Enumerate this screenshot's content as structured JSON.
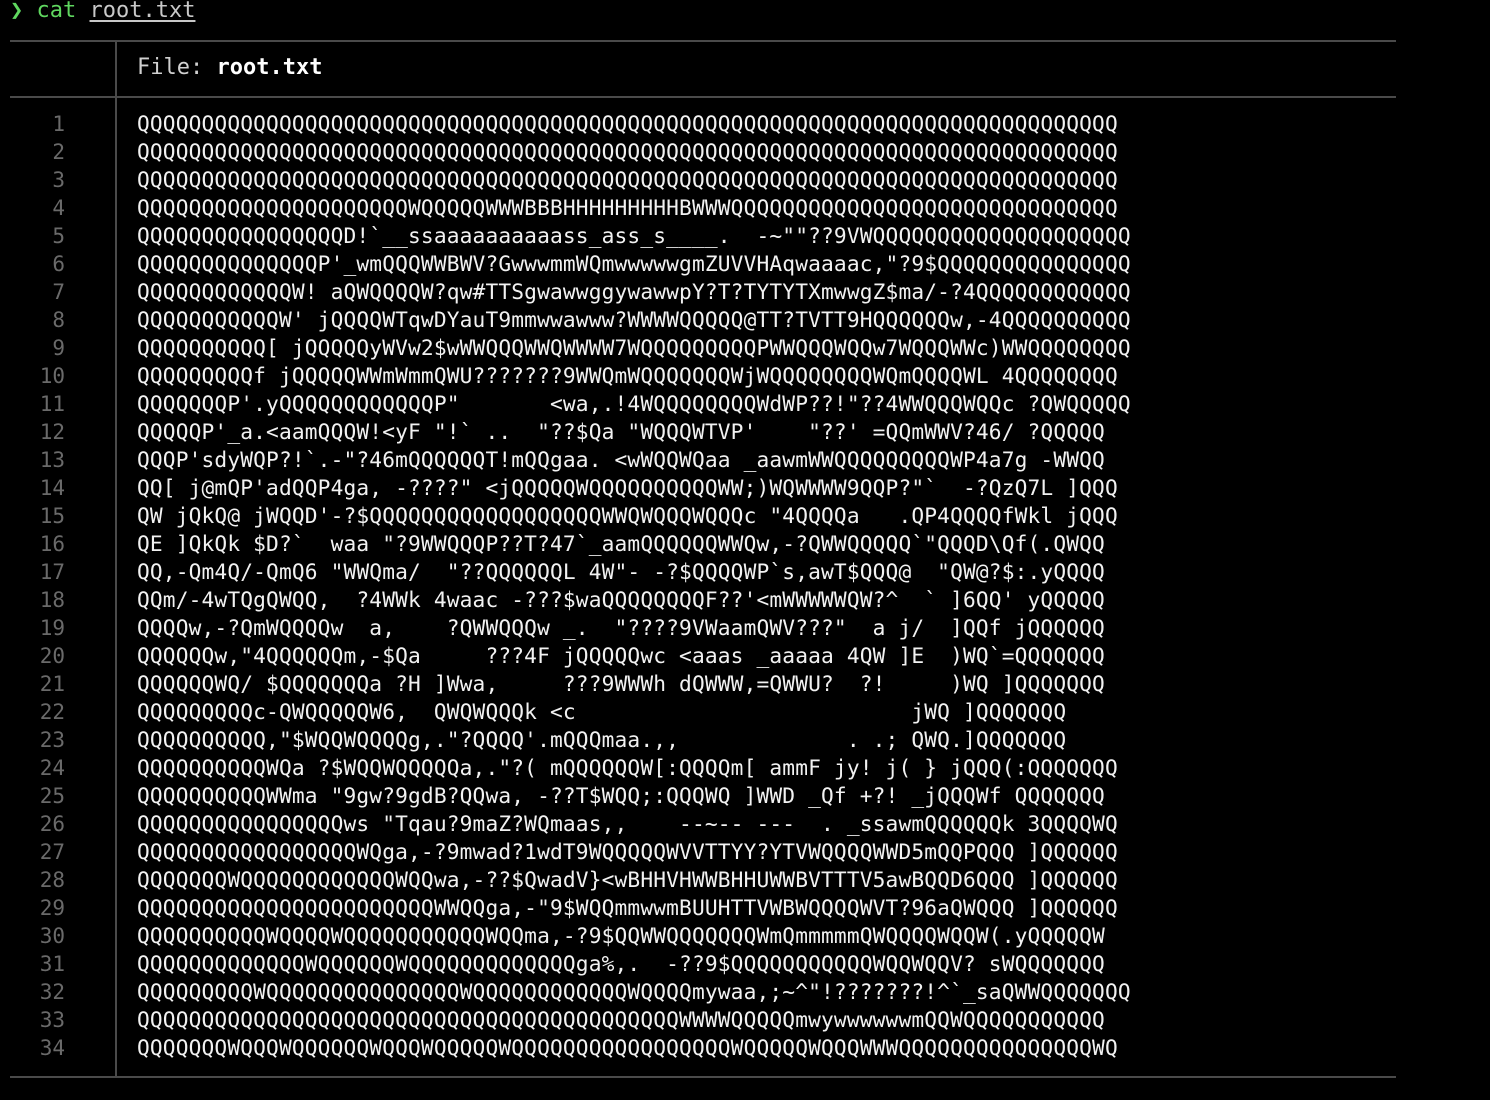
{
  "prompt": {
    "symbol": "❯",
    "command": "cat",
    "argument": "root.txt"
  },
  "header": {
    "label": "File:",
    "filename": "root.txt"
  },
  "lines": [
    {
      "n": "1",
      "text": "QQQQQQQQQQQQQQQQQQQQQQQQQQQQQQQQQQQQQQQQQQQQQQQQQQQQQQQQQQQQQQQQQQQQQQQQQQQQ"
    },
    {
      "n": "2",
      "text": "QQQQQQQQQQQQQQQQQQQQQQQQQQQQQQQQQQQQQQQQQQQQQQQQQQQQQQQQQQQQQQQQQQQQQQQQQQQQ"
    },
    {
      "n": "3",
      "text": "QQQQQQQQQQQQQQQQQQQQQQQQQQQQQQQQQQQQQQQQQQQQQQQQQQQQQQQQQQQQQQQQQQQQQQQQQQQQ"
    },
    {
      "n": "4",
      "text": "QQQQQQQQQQQQQQQQQQQQQWQQQQQWWWBBBHHHHHHHHHBWWWQQQQQQQQQQQQQQQQQQQQQQQQQQQQQQ"
    },
    {
      "n": "5",
      "text": "QQQQQQQQQQQQQQQQD!`__ssaaaaaaaaaass_ass_s____.  -~\"\"??9VWQQQQQQQQQQQQQQQQQQQQ"
    },
    {
      "n": "6",
      "text": "QQQQQQQQQQQQQQP'_wmQQQWWBWV?GwwwmmWQmwwwwwgmZUVVHAqwaaaac,\"?9$QQQQQQQQQQQQQQQ"
    },
    {
      "n": "7",
      "text": "QQQQQQQQQQQQW! aQWQQQQW?qw#TTSgwawwggywawwpY?T?TYTYTXmwwgZ$ma/-?4QQQQQQQQQQQQ"
    },
    {
      "n": "8",
      "text": "QQQQQQQQQQQW' jQQQQWTqwDYauT9mmwwawww?WWWWQQQQQ@TT?TVTT9HQQQQQQw,-4QQQQQQQQQQ"
    },
    {
      "n": "9",
      "text": "QQQQQQQQQQ[ jQQQQQyWVw2$wWWQQQWWQWWWW7WQQQQQQQQQPWWQQQWQQw7WQQQWWc)WWQQQQQQQQ"
    },
    {
      "n": "10",
      "text": "QQQQQQQQQf jQQQQQWWmWmmQWU???????9WWQmWQQQQQQQWjWQQQQQQQQWQmQQQQWL 4QQQQQQQQ"
    },
    {
      "n": "11",
      "text": "QQQQQQQP'.yQQQQQQQQQQQQP\"       <wa,.!4WQQQQQQQQWdWP??!\"??4WWQQQWQQc ?QWQQQQQ"
    },
    {
      "n": "12",
      "text": "QQQQQP'_a.<aamQQQW!<yF \"!` ..  \"??$Qa \"WQQQWTVP'    \"??' =QQmWWV?46/ ?QQQQQ"
    },
    {
      "n": "13",
      "text": "QQQP'sdyWQP?!`.-\"?46mQQQQQQT!mQQgaa. <wWQQWQaa _aawmWWQQQQQQQQQWP4a7g -WWQQ"
    },
    {
      "n": "14",
      "text": "QQ[ j@mQP'adQQP4ga, -????\" <jQQQQQWQQQQQQQQQQWW;)WQWWWW9QQP?\"`  -?QzQ7L ]QQQ"
    },
    {
      "n": "15",
      "text": "QW jQkQ@ jWQQD'-?$QQQQQQQQQQQQQQQQQQWWQWQQQWQQQc \"4QQQQa   .QP4QQQQfWkl jQQQ"
    },
    {
      "n": "16",
      "text": "QE ]QkQk $D?`  waa \"?9WWQQQP??T?47`_aamQQQQQQWWQw,-?QWWQQQQQ`\"QQQD\\Qf(.QWQQ"
    },
    {
      "n": "17",
      "text": "QQ,-Qm4Q/-QmQ6 \"WWQma/  \"??QQQQQQL 4W\"- -?$QQQQWP`s,awT$QQQ@  \"QW@?$:.yQQQQ"
    },
    {
      "n": "18",
      "text": "QQm/-4wTQgQWQQ,  ?4WWk 4waac -???$waQQQQQQQQF??'<mWWWWWQW?^  ` ]6QQ' yQQQQQ"
    },
    {
      "n": "19",
      "text": "QQQQw,-?QmWQQQQw  a,    ?QWWQQQw _.  \"????9VWaamQWV???\"  a j/  ]QQf jQQQQQQ"
    },
    {
      "n": "20",
      "text": "QQQQQQw,\"4QQQQQQm,-$Qa     ???4F jQQQQQwc <aaas _aaaaa 4QW ]E  )WQ`=QQQQQQQ"
    },
    {
      "n": "21",
      "text": "QQQQQQWQ/ $QQQQQQQa ?H ]Wwa,     ???9WWWh dQWWW,=QWWU?  ?!     )WQ ]QQQQQQQ"
    },
    {
      "n": "22",
      "text": "QQQQQQQQQc-QWQQQQQW6,  QWQWQQQk <c                          jWQ ]QQQQQQQ"
    },
    {
      "n": "23",
      "text": "QQQQQQQQQQ,\"$WQQWQQQQg,.\"?QQQQ'.mQQQmaa.,,             . .; QWQ.]QQQQQQQ"
    },
    {
      "n": "24",
      "text": "QQQQQQQQQQWQa ?$WQQWQQQQQa,.\"?( mQQQQQQW[:QQQQm[ ammF jy! j( } jQQQ(:QQQQQQQ"
    },
    {
      "n": "25",
      "text": "QQQQQQQQQQWWma \"9gw?9gdB?QQwa, -??T$WQQ;:QQQWQ ]WWD _Qf +?! _jQQQWf QQQQQQQ"
    },
    {
      "n": "26",
      "text": "QQQQQQQQQQQQQQQQws \"Tqau?9maZ?WQmaas,,    --~-- ---  . _ssawmQQQQQQk 3QQQQWQ"
    },
    {
      "n": "27",
      "text": "QQQQQQQQQQQQQQQQQWQga,-?9mwad?1wdT9WQQQQQWVVTTYY?YTVWQQQQWWD5mQQPQQQ ]QQQQQQ"
    },
    {
      "n": "28",
      "text": "QQQQQQQWQQQQQQQQQQQQWQQwa,-??$QwadV}<wBHHVHWWBHHUWWBVTTTV5awBQQD6QQQ ]QQQQQQ"
    },
    {
      "n": "29",
      "text": "QQQQQQQQQQQQQQQQQQQQQQQWWQQga,-\"9$WQQmmwwmBUUHTTVWBWQQQQWVT?96aQWQQQ ]QQQQQQ"
    },
    {
      "n": "30",
      "text": "QQQQQQQQQQWQQQQWQQQQQQQQQQQWQQma,-?9$QQWWQQQQQQQWmQmmmmmQWQQQQWQQW(.yQQQQQW"
    },
    {
      "n": "31",
      "text": "QQQQQQQQQQQQQWQQQQQQWQQQQQQQQQQQQQga%,.  -??9$QQQQQQQQQQQWQQWQQV? sWQQQQQQQ"
    },
    {
      "n": "32",
      "text": "QQQQQQQQQWQQQQQQQQQQQQQQQWQQQQQQQQQQQQWQQQQmywaa,;~^\"!???????!^`_saQWWQQQQQQQ"
    },
    {
      "n": "33",
      "text": "QQQQQQQQQQQQQQQQQQQQQQQQQQQQQQQQQQQQQQQQQQWWWWQQQQQmwywwwwwwmQQWQQQQQQQQQQQ"
    },
    {
      "n": "34",
      "text": "QQQQQQQWQQQWQQQQQQWQQQWQQQQQWQQQQQQQQQQQQQQQQQWQQQQQWQQQWWWQQQQQQQQQQQQQQQWQ"
    }
  ]
}
